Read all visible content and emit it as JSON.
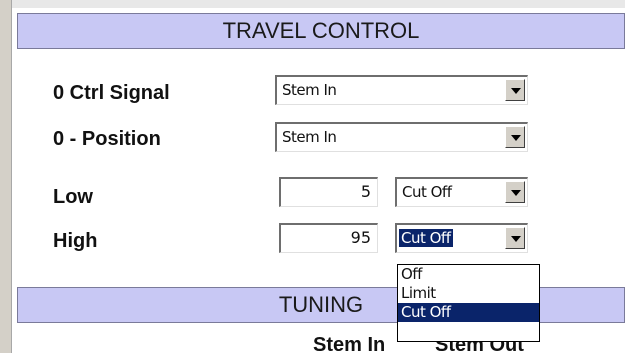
{
  "sections": {
    "travel_control": "TRAVEL CONTROL",
    "tuning": "TUNING"
  },
  "rows": {
    "ctrl_signal": {
      "label": "0 Ctrl Signal",
      "value": "Stem In"
    },
    "position": {
      "label": "0 - Position",
      "value": "Stem In"
    },
    "low": {
      "label": "Low",
      "number": "5",
      "mode": "Cut Off"
    },
    "high": {
      "label": "High",
      "number": "95",
      "mode": "Cut Off"
    }
  },
  "dropdown": {
    "options": [
      "Off",
      "Limit",
      "Cut Off"
    ],
    "selected": "Cut Off"
  },
  "tuning_columns": [
    "Stem In",
    "Stem Out"
  ],
  "icons": {
    "dropdown": "chevron-down-icon"
  },
  "colors": {
    "section_bar": "#c8c8f4",
    "selection": "#0a246a"
  }
}
